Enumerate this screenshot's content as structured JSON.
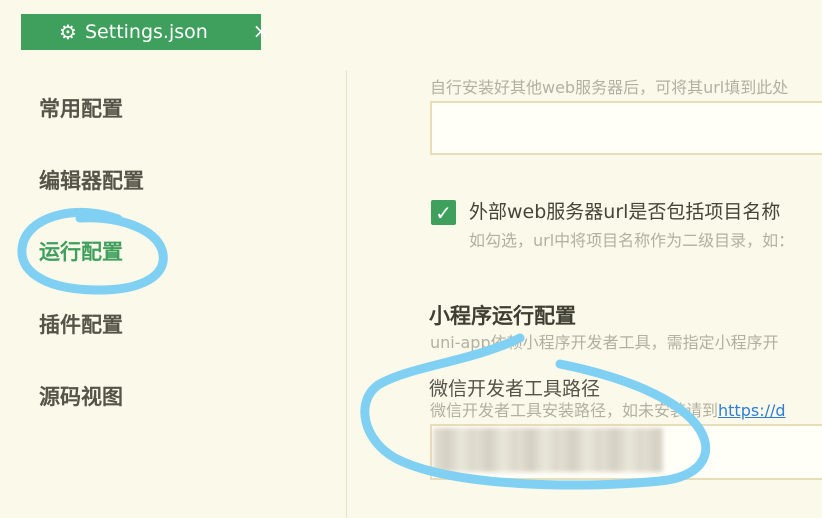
{
  "tab": {
    "title": "Settings.json",
    "icon": "gear-icon",
    "close_glyph": "×",
    "color": "#3f9f5d"
  },
  "sidebar": {
    "items": [
      {
        "label": "常用配置",
        "active": false
      },
      {
        "label": "编辑器配置",
        "active": false
      },
      {
        "label": "运行配置",
        "active": true
      },
      {
        "label": "插件配置",
        "active": false
      },
      {
        "label": "源码视图",
        "active": false
      }
    ]
  },
  "main": {
    "web_server_hint": "自行安装好其他web服务器后，可将其url填到此处",
    "web_server_url_value": "",
    "include_project_checkbox": {
      "label": "外部web服务器url是否包括项目名称",
      "checked": true,
      "hint": "如勾选，url中将项目名称作为二级目录，如："
    },
    "mini_program_section": {
      "title": "小程序运行配置",
      "hint": "uni-app依赖小程序开发者工具，需指定小程序开"
    },
    "wechat_devtools": {
      "label": "微信开发者工具路径",
      "hint_prefix": "微信开发者工具安装路径，如未安装请到",
      "hint_link": "https://d",
      "value_redacted": true
    }
  },
  "annotation_color": "#7fd0f2"
}
